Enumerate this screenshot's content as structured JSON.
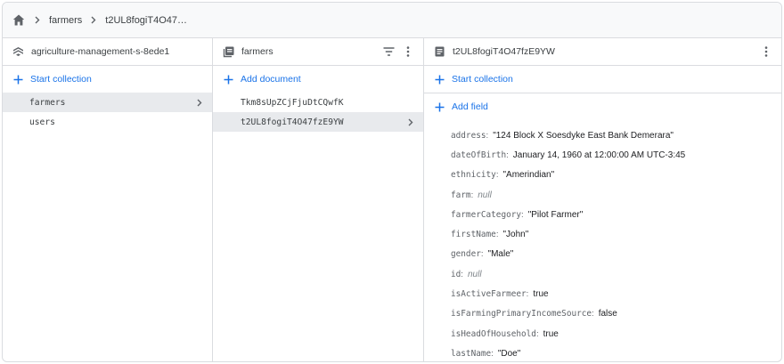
{
  "breadcrumb": {
    "home_icon": "home-icon",
    "items": [
      "farmers",
      "t2UL8fogiT4O47…"
    ]
  },
  "panel_project": {
    "title": "agriculture-management-s-8ede1",
    "start_collection": "Start collection",
    "collections": [
      "farmers",
      "users"
    ]
  },
  "panel_collection": {
    "title": "farmers",
    "add_document": "Add document",
    "documents": [
      "Tkm8sUpZCjFjuDtCQwfK",
      "t2UL8fogiT4O47fzE9YW"
    ]
  },
  "panel_document": {
    "title": "t2UL8fogiT4O47fzE9YW",
    "start_collection": "Start collection",
    "add_field": "Add field",
    "fields": [
      {
        "key": "address",
        "value": "\"124 Block X Soesdyke East Bank Demerara\""
      },
      {
        "key": "dateOfBirth",
        "value": "January 14, 1960 at 12:00:00 AM UTC-3:45"
      },
      {
        "key": "ethnicity",
        "value": "\"Amerindian\""
      },
      {
        "key": "farm",
        "value": "null"
      },
      {
        "key": "farmerCategory",
        "value": "\"Pilot Farmer\""
      },
      {
        "key": "firstName",
        "value": "\"John\""
      },
      {
        "key": "gender",
        "value": "\"Male\""
      },
      {
        "key": "id",
        "value": "null"
      },
      {
        "key": "isActiveFarmeer",
        "value": "true"
      },
      {
        "key": "isFarmingPrimaryIncomeSource",
        "value": "false"
      },
      {
        "key": "isHeadOfHousehold",
        "value": "true"
      },
      {
        "key": "lastName",
        "value": "\"Doe\""
      }
    ]
  },
  "colors": {
    "accent": "#1a73e8",
    "selected_bg": "#e8eaed",
    "border": "#dadce0"
  }
}
